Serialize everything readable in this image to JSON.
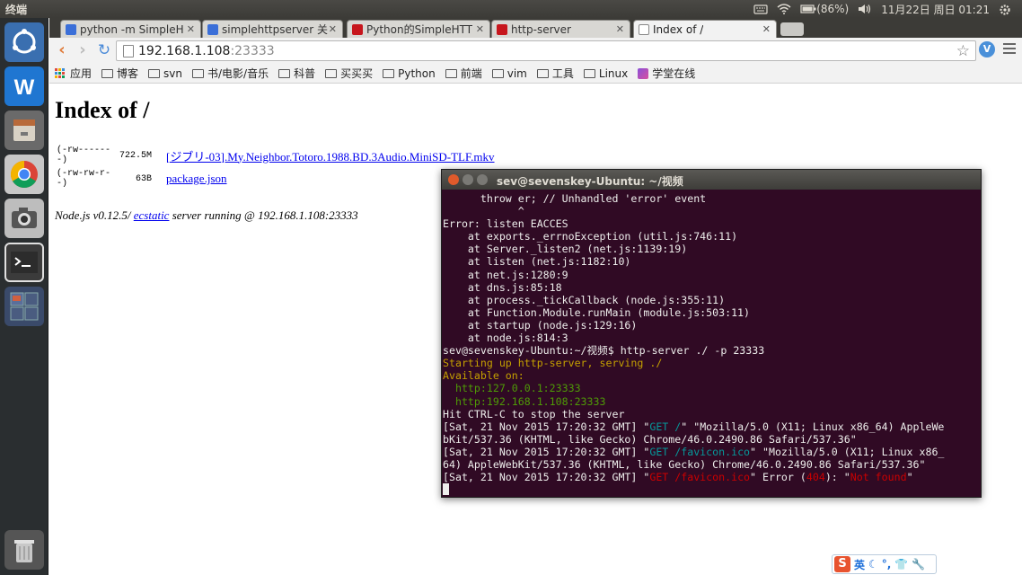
{
  "top_panel": {
    "app_title": "终端",
    "battery": "(86%)",
    "datetime": "11月22日 周日 01:21"
  },
  "launcher": {
    "items": [
      "ubuntu-dash",
      "wps-writer",
      "files",
      "chrome",
      "camera",
      "terminal",
      "workspace-switcher",
      "trash"
    ]
  },
  "browser": {
    "tabs": [
      {
        "label": "python -m SimpleH",
        "favicon_color": "#3b6fd8",
        "active": false
      },
      {
        "label": "simplehttpserver 关",
        "favicon_color": "#3b6fd8",
        "active": false
      },
      {
        "label": "Python的SimpleHTT",
        "favicon_color": "#c7161d",
        "active": false
      },
      {
        "label": "http-server",
        "favicon_color": "#c7161d",
        "active": false
      },
      {
        "label": "Index of /",
        "favicon_color": "#ffffff",
        "active": true
      }
    ],
    "url_host": "192.168.1.108",
    "url_port": ":23333",
    "bookmarks": [
      {
        "label": "应用",
        "type": "apps"
      },
      {
        "label": "博客",
        "type": "folder"
      },
      {
        "label": "svn",
        "type": "folder"
      },
      {
        "label": "书/电影/音乐",
        "type": "folder"
      },
      {
        "label": "科普",
        "type": "folder"
      },
      {
        "label": "买买买",
        "type": "folder"
      },
      {
        "label": "Python",
        "type": "folder"
      },
      {
        "label": "前端",
        "type": "folder"
      },
      {
        "label": "vim",
        "type": "folder"
      },
      {
        "label": "工具",
        "type": "folder"
      },
      {
        "label": "Linux",
        "type": "folder"
      },
      {
        "label": "学堂在线",
        "type": "site"
      }
    ]
  },
  "page": {
    "heading": "Index of /",
    "files": [
      {
        "perms": "(-rw-------)",
        "size": "722.5M",
        "name": "[ジブリ-03].My.Neighbor.Totoro.1988.BD.3Audio.MiniSD-TLF.mkv"
      },
      {
        "perms": "(-rw-rw-r--)",
        "size": "63B",
        "name": "package.json"
      }
    ],
    "footer_pre": "Node.js v0.12.5/ ",
    "footer_link": "ecstatic",
    "footer_post": " server running @ 192.168.1.108:23333"
  },
  "terminal": {
    "title": "sev@sevenskey-Ubuntu: ~/视频",
    "lines": [
      {
        "segs": [
          {
            "t": "      throw er; // Unhandled 'error' event",
            "c": ""
          }
        ]
      },
      {
        "segs": [
          {
            "t": "            ^",
            "c": ""
          }
        ]
      },
      {
        "segs": [
          {
            "t": "Error: listen EACCES",
            "c": ""
          }
        ]
      },
      {
        "segs": [
          {
            "t": "    at exports._errnoException (util.js:746:11)",
            "c": ""
          }
        ]
      },
      {
        "segs": [
          {
            "t": "    at Server._listen2 (net.js:1139:19)",
            "c": ""
          }
        ]
      },
      {
        "segs": [
          {
            "t": "    at listen (net.js:1182:10)",
            "c": ""
          }
        ]
      },
      {
        "segs": [
          {
            "t": "    at net.js:1280:9",
            "c": ""
          }
        ]
      },
      {
        "segs": [
          {
            "t": "    at dns.js:85:18",
            "c": ""
          }
        ]
      },
      {
        "segs": [
          {
            "t": "    at process._tickCallback (node.js:355:11)",
            "c": ""
          }
        ]
      },
      {
        "segs": [
          {
            "t": "    at Function.Module.runMain (module.js:503:11)",
            "c": ""
          }
        ]
      },
      {
        "segs": [
          {
            "t": "    at startup (node.js:129:16)",
            "c": ""
          }
        ]
      },
      {
        "segs": [
          {
            "t": "    at node.js:814:3",
            "c": ""
          }
        ]
      },
      {
        "segs": [
          {
            "t": "sev@sevenskey-Ubuntu:~/视频$ http-server ./ -p 23333",
            "c": ""
          }
        ]
      },
      {
        "segs": [
          {
            "t": "Starting up http-server, serving ./",
            "c": "y"
          }
        ]
      },
      {
        "segs": [
          {
            "t": "Available on:",
            "c": "y"
          }
        ]
      },
      {
        "segs": [
          {
            "t": "  http:127.0.0.1:23333",
            "c": "g"
          }
        ]
      },
      {
        "segs": [
          {
            "t": "  http:192.168.1.108:23333",
            "c": "g"
          }
        ]
      },
      {
        "segs": [
          {
            "t": "Hit CTRL-C to stop the server",
            "c": ""
          }
        ]
      },
      {
        "segs": [
          {
            "t": "[Sat, 21 Nov 2015 17:20:32 GMT] \"",
            "c": ""
          },
          {
            "t": "GET /",
            "c": "c"
          },
          {
            "t": "\" \"Mozilla/5.0 (X11; Linux x86_64) AppleWe",
            "c": ""
          }
        ]
      },
      {
        "segs": [
          {
            "t": "bKit/537.36 (KHTML, like Gecko) Chrome/46.0.2490.86 Safari/537.36\"",
            "c": ""
          }
        ]
      },
      {
        "segs": [
          {
            "t": "[Sat, 21 Nov 2015 17:20:32 GMT] \"",
            "c": ""
          },
          {
            "t": "GET /favicon.ico",
            "c": "c"
          },
          {
            "t": "\" \"Mozilla/5.0 (X11; Linux x86_",
            "c": ""
          }
        ]
      },
      {
        "segs": [
          {
            "t": "64) AppleWebKit/537.36 (KHTML, like Gecko) Chrome/46.0.2490.86 Safari/537.36\"",
            "c": ""
          }
        ]
      },
      {
        "segs": [
          {
            "t": "[Sat, 21 Nov 2015 17:20:32 GMT] \"",
            "c": ""
          },
          {
            "t": "GET /favicon.ico",
            "c": "r"
          },
          {
            "t": "\" Error (",
            "c": ""
          },
          {
            "t": "404",
            "c": "r"
          },
          {
            "t": "): \"",
            "c": ""
          },
          {
            "t": "Not found",
            "c": "r"
          },
          {
            "t": "\"",
            "c": ""
          }
        ]
      }
    ]
  },
  "ime": {
    "mode_label": "英"
  },
  "colors": {
    "panel": "#3c3b37",
    "launcher": "#2a2e30",
    "terminal_bg": "#300a24",
    "term_yellow": "#c4a000",
    "term_green": "#4e9a06",
    "term_cyan": "#06989a",
    "term_red": "#cc0000",
    "link": "#0000ee"
  }
}
